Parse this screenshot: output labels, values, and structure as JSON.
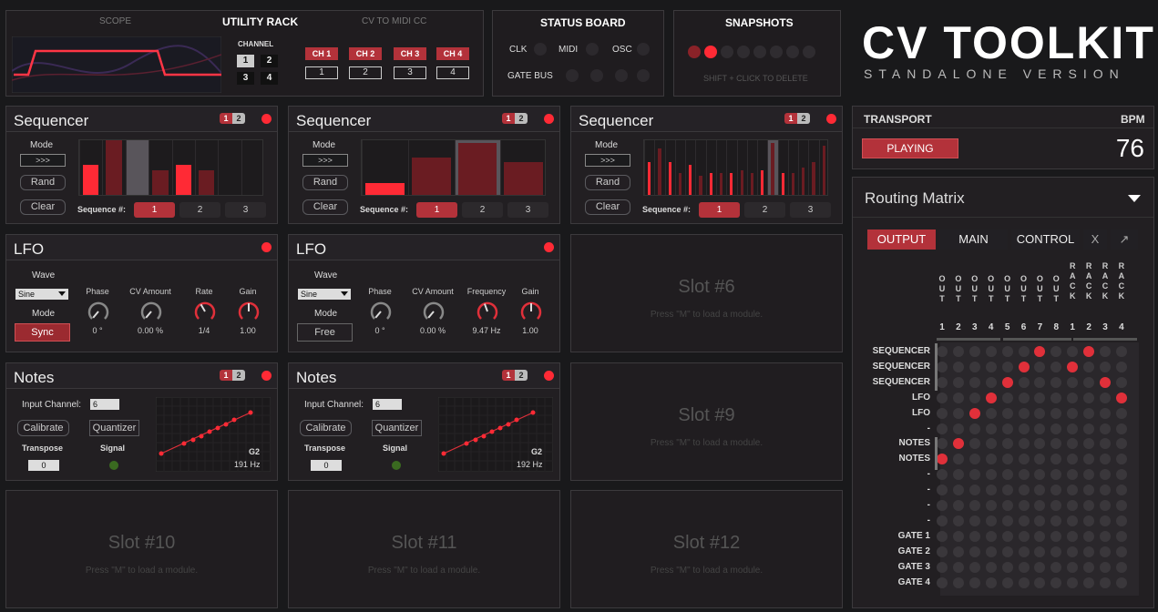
{
  "brand": {
    "title": "CV TOOLKIT",
    "subtitle": "STANDALONE VERSION"
  },
  "utility": {
    "title": "UTILITY RACK",
    "scope": "SCOPE",
    "cv_to_midi": "CV TO MIDI CC",
    "channel": "CHANNEL",
    "ch_buttons": [
      "1",
      "2",
      "3",
      "4"
    ],
    "cc_labels": [
      "CH 1",
      "CH 2",
      "CH 3",
      "CH 4"
    ],
    "cc_values": [
      "1",
      "2",
      "3",
      "4"
    ]
  },
  "status": {
    "title": "STATUS BOARD",
    "clk": "CLK",
    "midi": "MIDI",
    "osc": "OSC",
    "gate_bus": "GATE BUS"
  },
  "snapshots": {
    "title": "SNAPSHOTS",
    "hint": "SHIFT + CLICK TO DELETE"
  },
  "transport": {
    "title": "TRANSPORT",
    "bpm_label": "BPM",
    "playing": "PLAYING",
    "bpm": "76"
  },
  "routing": {
    "title": "Routing Matrix",
    "tabs": [
      "OUTPUT",
      "MAIN",
      "CONTROL"
    ],
    "close": "X",
    "expand": "↗",
    "col_headers": [
      "OUT",
      "OUT",
      "OUT",
      "OUT",
      "OUT",
      "OUT",
      "OUT",
      "OUT",
      "RACK",
      "RACK",
      "RACK",
      "RACK"
    ],
    "col_nums": [
      "1",
      "2",
      "3",
      "4",
      "5",
      "6",
      "7",
      "8",
      "1",
      "2",
      "3",
      "4"
    ],
    "rows": [
      "SEQUENCER",
      "SEQUENCER",
      "SEQUENCER",
      "LFO",
      "LFO",
      "-",
      "NOTES",
      "NOTES",
      "-",
      "-",
      "-",
      "-",
      "GATE 1",
      "GATE 2",
      "GATE 3",
      "GATE 4"
    ]
  },
  "seq": {
    "title": "Sequencer",
    "mode": "Mode",
    "mode_val": ">>>",
    "rand": "Rand",
    "clear": "Clear",
    "seqnum": "Sequence #:",
    "nums": [
      "1",
      "2",
      "3"
    ],
    "p1": "1",
    "p2": "2"
  },
  "lfo": {
    "title": "LFO",
    "wave": "Wave",
    "wave_val": "Sine",
    "mode": "Mode",
    "sync": "Sync",
    "free": "Free",
    "phase": "Phase",
    "cv": "CV Amount",
    "rate": "Rate",
    "freq": "Frequency",
    "gain": "Gain",
    "phase_v": "0 °",
    "cv_v": "0.00 %",
    "rate_v": "1/4",
    "freq_v": "9.47 Hz",
    "gain_v": "1.00"
  },
  "notes": {
    "title": "Notes",
    "input": "Input Channel:",
    "input_v": "6",
    "calibrate": "Calibrate",
    "quantizer": "Quantizer",
    "transpose": "Transpose",
    "transpose_v": "0",
    "signal": "Signal",
    "note": "G2",
    "hz1": "191 Hz",
    "hz2": "192 Hz"
  },
  "slots": {
    "s6": "Slot #6",
    "s9": "Slot #9",
    "s10": "Slot #10",
    "s11": "Slot #11",
    "s12": "Slot #12",
    "hint": "Press \"M\" to load a module."
  }
}
